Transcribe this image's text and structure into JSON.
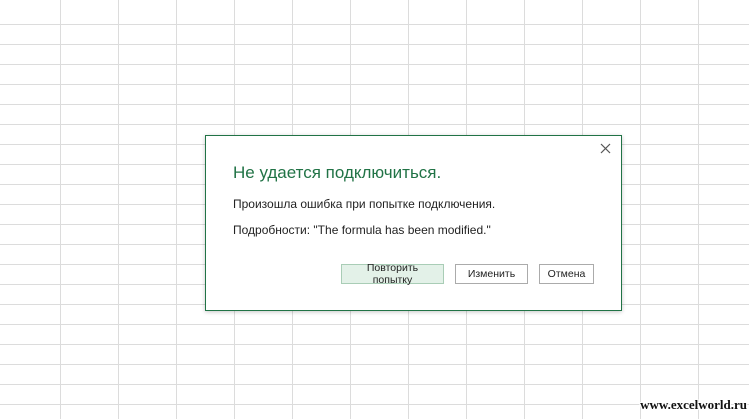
{
  "dialog": {
    "title": "Не удается подключиться.",
    "message": "Произошла ошибка при попытке подключения.",
    "details": "Подробности: \"The formula has been modified.\"",
    "close_icon": "close-icon",
    "buttons": {
      "retry": "Повторить попытку",
      "edit": "Изменить",
      "cancel": "Отмена"
    }
  },
  "watermark": "www.excelworld.ru",
  "colors": {
    "accent": "#217346",
    "primary_button_bg": "#e3f1e8",
    "grid_line": "#dcdcdc"
  }
}
